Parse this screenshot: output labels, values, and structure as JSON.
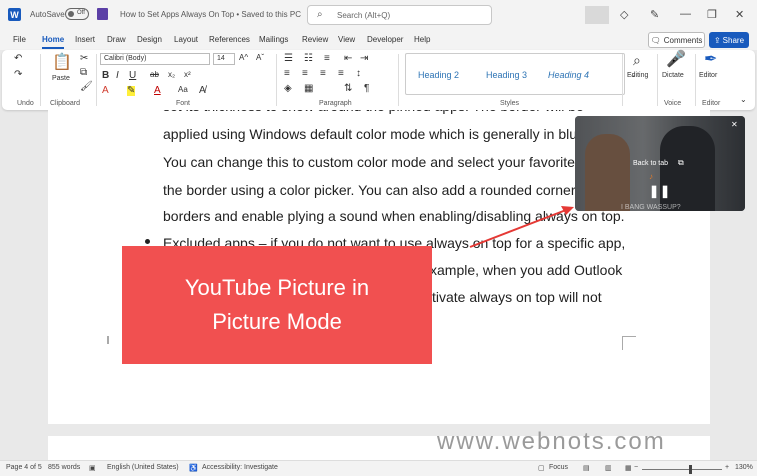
{
  "titlebar": {
    "app_icon": "W",
    "autosave_label": "AutoSave",
    "autosave_state": "Off",
    "doc_title": "How to Set Apps Always On Top • Saved to this PC",
    "search_placeholder": "Search (Alt+Q)"
  },
  "menu": {
    "tabs": [
      "File",
      "Home",
      "Insert",
      "Draw",
      "Design",
      "Layout",
      "References",
      "Mailings",
      "Review",
      "View",
      "Developer",
      "Help"
    ],
    "comments": "Comments",
    "share": "Share"
  },
  "ribbon": {
    "font_name": "Calibri (Body)",
    "font_size": "14",
    "paste": "Paste",
    "styles": [
      "Heading 2",
      "Heading 3",
      "Heading 4"
    ],
    "editing": "Editing",
    "dictate": "Dictate",
    "editor": "Editor",
    "groups": [
      "Undo",
      "Clipboard",
      "Font",
      "Paragraph",
      "Styles",
      "Voice",
      "Editor"
    ]
  },
  "document": {
    "lines": [
      "set its thickness to show around the pinned apps. The border will be",
      "applied using Windows default color mode which is generally in blue.",
      "You can change this to custom color mode and select your favorite c",
      "the border using a color picker. You can also add a rounded corner to",
      "borders and enable plying a sound when enabling/disabling always on top.",
      "Excluded apps – if you do not want to use always on top for a specific app,",
      "xample, when you add Outlook",
      "tivate always on top will not"
    ]
  },
  "callout": {
    "line1": "YouTube Picture in",
    "line2": "Picture Mode"
  },
  "pip": {
    "back_to_tab": "Back to tab",
    "caption": "I BANG WASSUP?"
  },
  "watermark": "www.webnots.com",
  "statusbar": {
    "page": "Page 4 of 5",
    "words": "855 words",
    "language": "English (United States)",
    "accessibility": "Accessibility: Investigate",
    "focus": "Focus",
    "zoom": "130%",
    "zoom_level": 0.6
  },
  "colors": {
    "accent": "#185abd",
    "callout": "#f15050"
  }
}
